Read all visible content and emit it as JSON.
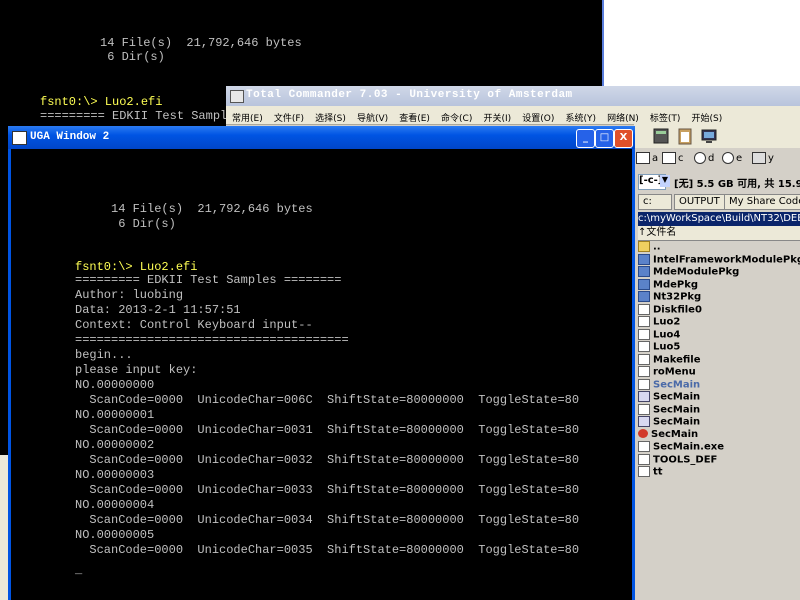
{
  "bg_console": {
    "lines": [
      "     14 File(s)  21,792,646 bytes",
      "      6 Dir(s)",
      "fsnt0:\\> Luo2.efi",
      "========= EDKII Test Samples ="
    ]
  },
  "tc": {
    "title": "Total Commander 7.03 - University of Amsterdam",
    "menu": [
      "常用(E)",
      "文件(F)",
      "选择(S)",
      "导航(V)",
      "查看(E)",
      "命令(C)",
      "开关(I)",
      "设置(O)",
      "系统(Y)",
      "网络(N)",
      "标签(T)",
      "开始(S)"
    ],
    "drives": [
      "a",
      "c",
      "d",
      "e",
      "y"
    ],
    "drive_select": "[-c-]",
    "drive_info": "[无]  5.5 GB 可用, 共 15.9",
    "tabs": [
      "c:",
      "OUTPUT",
      "My Share Codes"
    ],
    "path": "c:\\myWorkSpace\\Build\\NT32\\DEBU",
    "col_header": "↑文件名",
    "files": [
      {
        "name": "..",
        "kind": "up"
      },
      {
        "name": "IntelFrameworkModulePkg",
        "kind": "folder"
      },
      {
        "name": "MdeModulePkg",
        "kind": "folder"
      },
      {
        "name": "MdePkg",
        "kind": "folder"
      },
      {
        "name": "Nt32Pkg",
        "kind": "folder"
      },
      {
        "name": "Diskfile0",
        "kind": "file"
      },
      {
        "name": "Luo2",
        "kind": "file"
      },
      {
        "name": "Luo4",
        "kind": "file"
      },
      {
        "name": "Luo5",
        "kind": "file"
      },
      {
        "name": "Makefile",
        "kind": "file"
      },
      {
        "name": "roMenu",
        "kind": "file"
      },
      {
        "name": "SecMain",
        "kind": "file",
        "color": "#4a6aa8"
      },
      {
        "name": "SecMain",
        "kind": "exe"
      },
      {
        "name": "SecMain",
        "kind": "file"
      },
      {
        "name": "SecMain",
        "kind": "exe"
      },
      {
        "name": "SecMain",
        "kind": "red"
      },
      {
        "name": "SecMain.exe",
        "kind": "file"
      },
      {
        "name": "TOOLS_DEF",
        "kind": "file"
      },
      {
        "name": "tt",
        "kind": "file"
      }
    ]
  },
  "uga": {
    "title": "UGA Window 2",
    "buttons": {
      "minimize": "_",
      "maximize": "□",
      "close": "X"
    },
    "lines": [
      "     14 File(s)  21,792,646 bytes",
      "      6 Dir(s)",
      "fsnt0:\\> Luo2.efi",
      "========= EDKII Test Samples ========",
      "Author: luobing",
      "Data: 2013-2-1 11:57:51",
      "Context: Control Keyboard input--",
      "======================================",
      "begin...",
      "please input key:",
      "NO.00000000",
      "  ScanCode=0000  UnicodeChar=006C  ShiftState=80000000  ToggleState=80",
      "NO.00000001",
      "  ScanCode=0000  UnicodeChar=0031  ShiftState=80000000  ToggleState=80",
      "NO.00000002",
      "  ScanCode=0000  UnicodeChar=0032  ShiftState=80000000  ToggleState=80",
      "NO.00000003",
      "  ScanCode=0000  UnicodeChar=0033  ShiftState=80000000  ToggleState=80",
      "NO.00000004",
      "  ScanCode=0000  UnicodeChar=0034  ShiftState=80000000  ToggleState=80",
      "NO.00000005",
      "  ScanCode=0000  UnicodeChar=0035  ShiftState=80000000  ToggleState=80",
      "_"
    ]
  },
  "colors": {
    "prompt": "#ffff54",
    "console_text": "#c0c0c0",
    "xp_blue": "#0054e3"
  }
}
